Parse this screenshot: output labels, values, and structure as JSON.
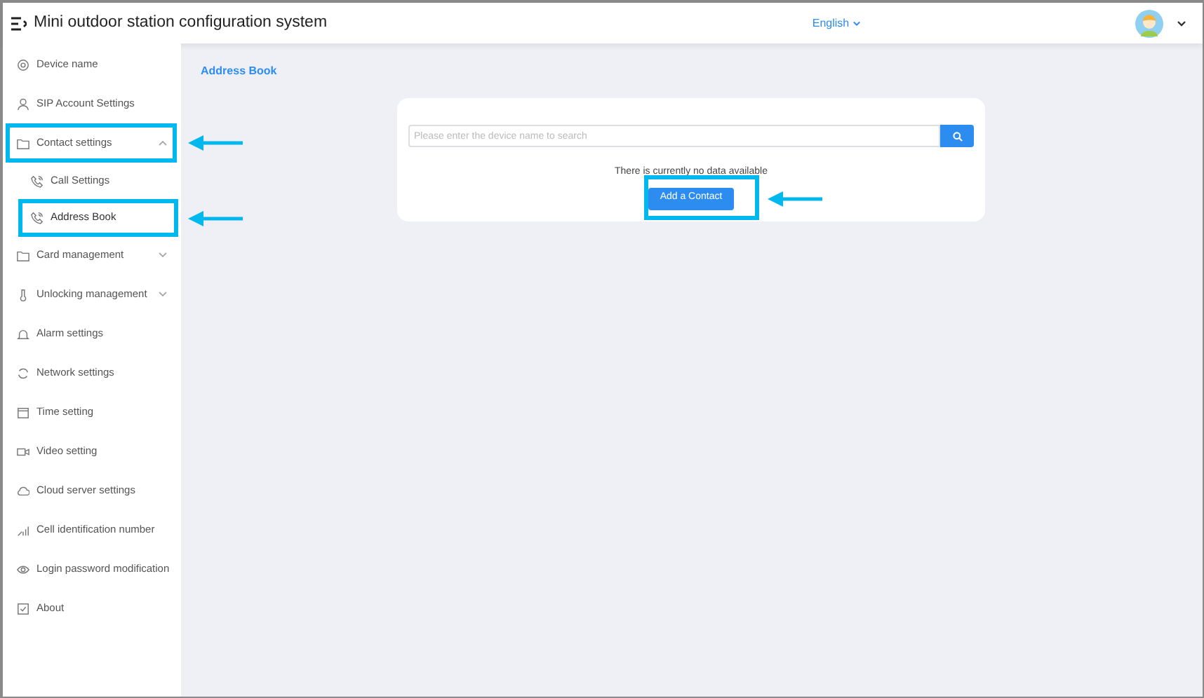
{
  "header": {
    "title": "Mini outdoor station configuration system",
    "language": "English"
  },
  "sidebar": {
    "items": [
      {
        "label": "Device name",
        "selected": false
      },
      {
        "label": "SIP Account Settings",
        "selected": false
      },
      {
        "label": "Contact settings",
        "expandable": true,
        "expanded": true,
        "selected": false,
        "highlighted": true,
        "children": [
          {
            "label": "Call Settings",
            "selected": false
          },
          {
            "label": "Address Book",
            "selected": true,
            "highlighted": true
          }
        ]
      },
      {
        "label": "Card management",
        "expandable": true,
        "expanded": false,
        "selected": false
      },
      {
        "label": "Unlocking management",
        "expandable": true,
        "expanded": false,
        "selected": false
      },
      {
        "label": "Alarm settings",
        "selected": false
      },
      {
        "label": "Network settings",
        "selected": false
      },
      {
        "label": "Time setting",
        "selected": false
      },
      {
        "label": "Video setting",
        "selected": false
      },
      {
        "label": "Cloud server settings",
        "selected": false
      },
      {
        "label": "Cell identification number",
        "selected": false
      },
      {
        "label": "Login password modification",
        "selected": false
      },
      {
        "label": "About",
        "selected": false
      }
    ]
  },
  "content": {
    "title": "Address Book",
    "search": {
      "placeholder": "Please enter the device name to search"
    },
    "empty_text": "There is currently no data available",
    "add_button": {
      "label": "Add a Contact",
      "highlighted": true
    }
  }
}
